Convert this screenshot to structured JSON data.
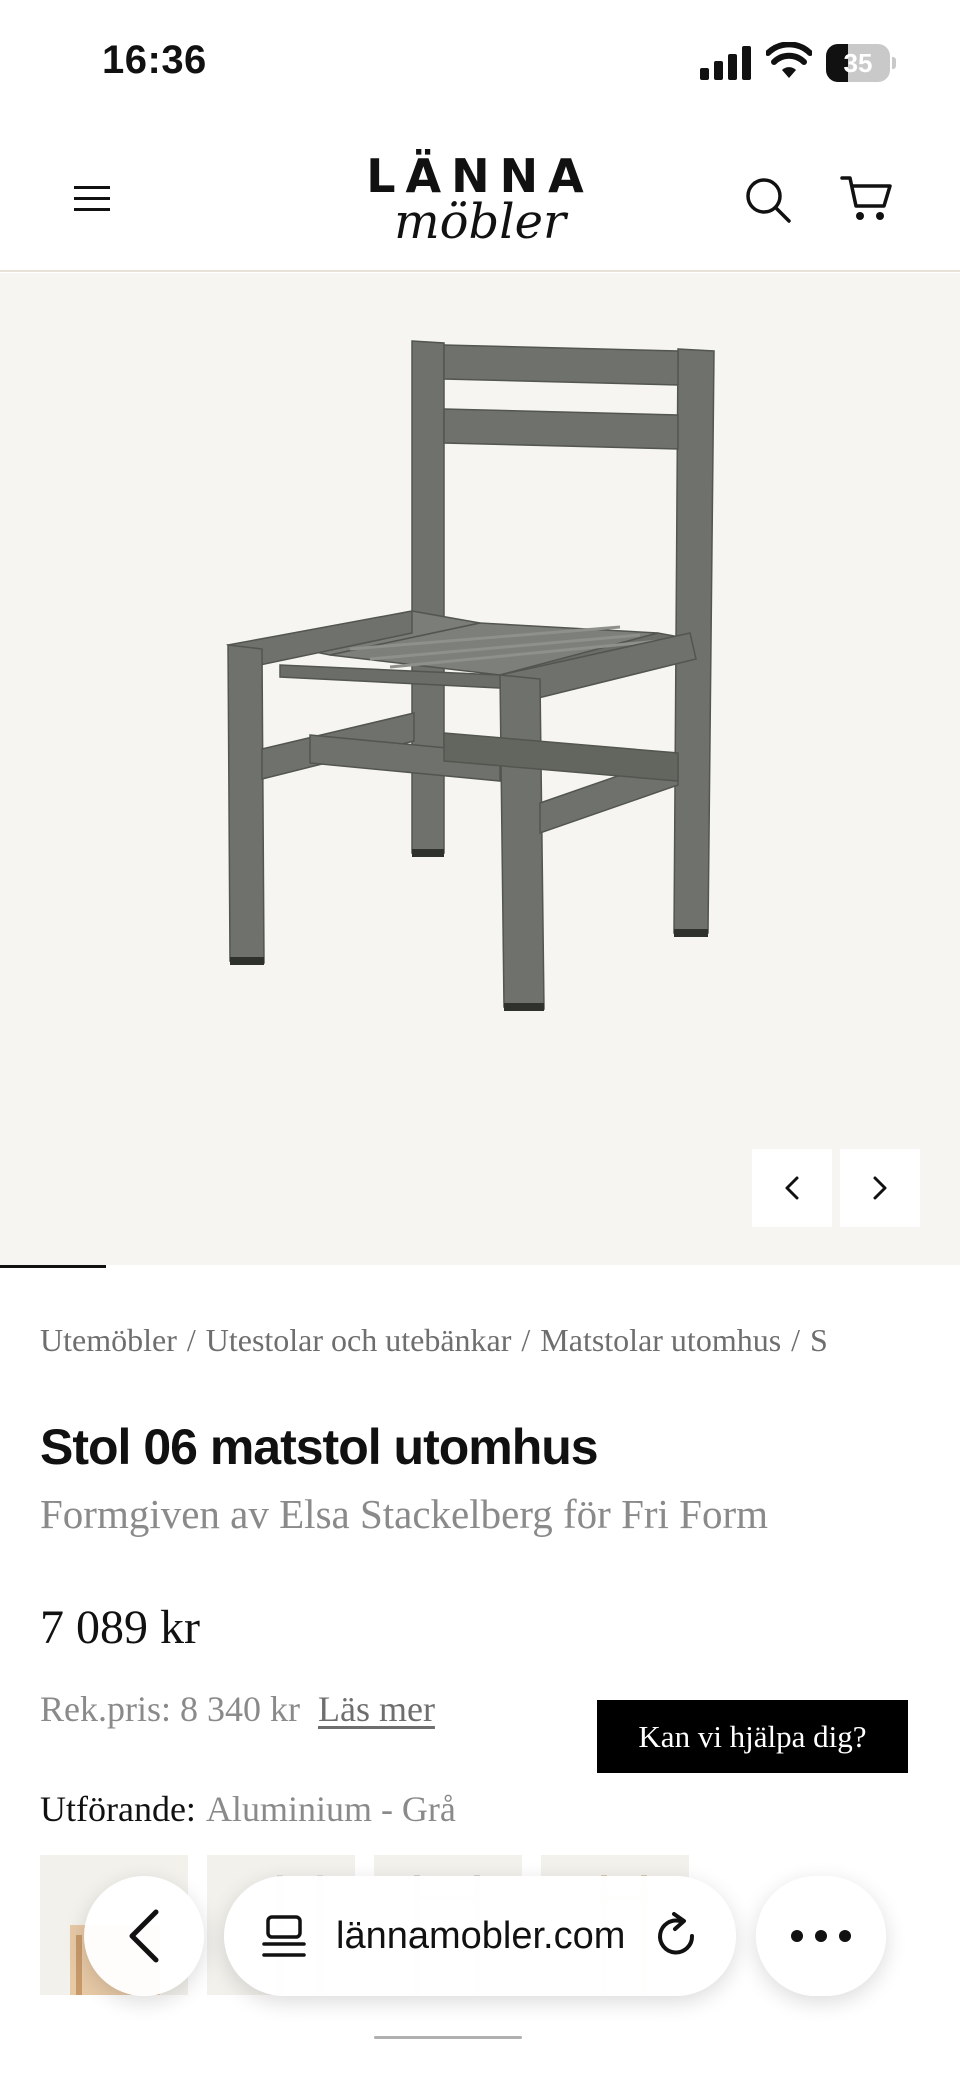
{
  "status_bar": {
    "time": "16:36",
    "battery_level": "35",
    "battery_fraction": 0.35
  },
  "header": {
    "logo_top": "LÄNNA",
    "logo_bottom": "möbler",
    "icons": [
      "menu-icon",
      "search-icon",
      "cart-icon"
    ]
  },
  "gallery": {
    "image_subject": "chair",
    "progress_fraction": 0.11,
    "colors": {
      "background": "#f6f5f2",
      "chair": "#6e716c"
    }
  },
  "breadcrumb": [
    "Utemöbler",
    "Utestolar och utebänkar",
    "Matstolar utomhus",
    "S"
  ],
  "product": {
    "title": "Stol 06 matstol utomhus",
    "designer": "Formgiven av Elsa Stackelberg för Fri Form",
    "price": "7 089 kr",
    "rek_price": "Rek.pris: 8 340 kr",
    "read_more": "Läs mer",
    "variant_label": "Utförande:",
    "variant_value": "Aluminium - Grå"
  },
  "help_button": "Kan vi hjälpa dig?",
  "browser": {
    "url": "lännamobler.com",
    "icons": [
      "back-icon",
      "tabs-icon",
      "reload-icon",
      "more-icon"
    ]
  }
}
